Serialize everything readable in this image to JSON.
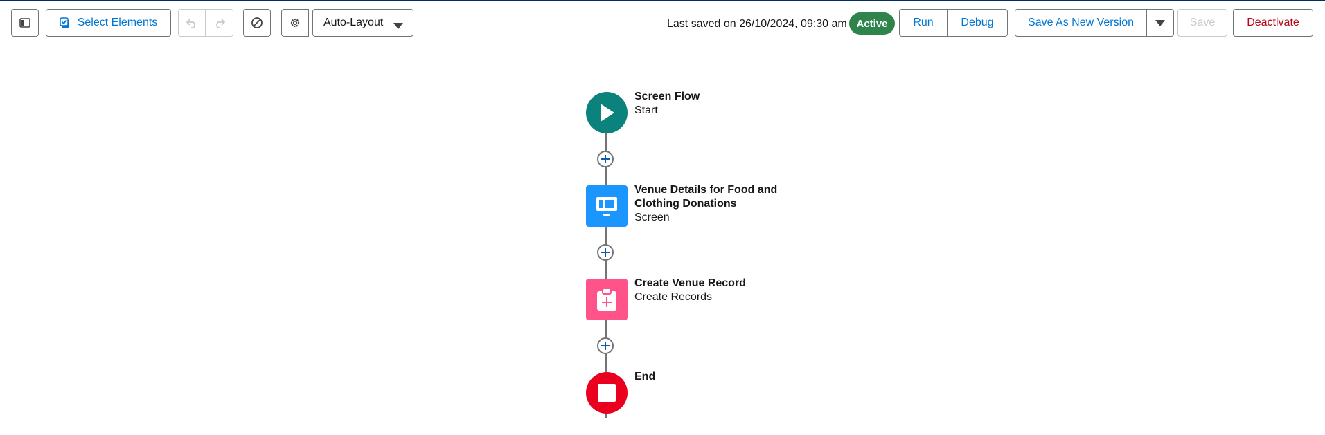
{
  "toolbar": {
    "select_elements_label": "Select Elements",
    "layout_value": "Auto-Layout",
    "last_saved": "Last saved on 26/10/2024, 09:30 am",
    "status_badge": "Active",
    "run_label": "Run",
    "debug_label": "Debug",
    "save_as_new_version_label": "Save As New Version",
    "save_label": "Save",
    "deactivate_label": "Deactivate"
  },
  "icons": {
    "panel_toggle": "sidebar-toggle-icon",
    "select": "checkbox-select-icon",
    "undo": "undo-icon",
    "redo": "redo-icon",
    "no_entry": "ban-icon",
    "settings": "gear-icon",
    "dropdown": "chevron-down-icon"
  },
  "flow": {
    "nodes": [
      {
        "title": "Screen Flow",
        "subtitle": "Start",
        "icon": "play-icon",
        "color": "#0b827c"
      },
      {
        "title": "Venue Details for Food and Clothing Donations",
        "subtitle": "Screen",
        "icon": "screen-icon",
        "color": "#1b96ff"
      },
      {
        "title": "Create Venue Record",
        "subtitle": "Create Records",
        "icon": "create-record-icon",
        "color": "#ff538a"
      },
      {
        "title": "End",
        "subtitle": "",
        "icon": "stop-icon",
        "color": "#ea001e"
      }
    ]
  },
  "colors": {
    "brand_blue": "#0176d3",
    "active_green": "#2e844a",
    "deactivate_red": "#ba0517"
  }
}
